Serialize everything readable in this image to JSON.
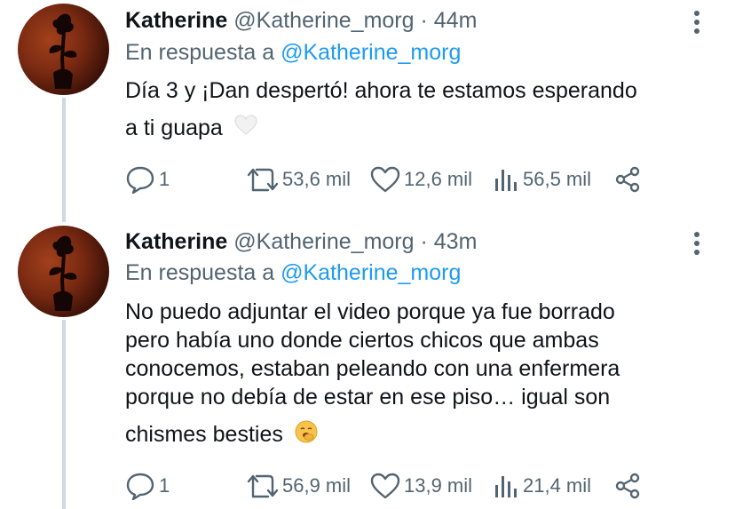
{
  "tweets": [
    {
      "author_name": "Katherine",
      "handle": "@Katherine_morg",
      "separator": "·",
      "time": "44m",
      "reply_prefix": "En respuesta a",
      "reply_handle": "@Katherine_morg",
      "text_lines": [
        "Día 3 y ¡Dan despertó! ahora te estamos esperando",
        "a ti guapa"
      ],
      "emoji": "white-heart-icon",
      "replies": "1",
      "retweets": "53,6 mil",
      "likes": "12,6 mil",
      "views": "56,5 mil"
    },
    {
      "author_name": "Katherine",
      "handle": "@Katherine_morg",
      "separator": "·",
      "time": "43m",
      "reply_prefix": "En respuesta a",
      "reply_handle": "@Katherine_morg",
      "text_lines": [
        "No puedo adjuntar el video porque ya fue borrado",
        "pero había uno donde ciertos chicos que ambas",
        "conocemos, estaban peleando con una enfermera",
        "porque no debía de estar en ese piso… igual son",
        "chismes besties"
      ],
      "emoji": "yawning-face-icon",
      "replies": "1",
      "retweets": "56,9 mil",
      "likes": "13,9 mil",
      "views": "21,4 mil"
    }
  ],
  "colors": {
    "text": "#0f1419",
    "muted": "#536471",
    "link": "#1d9bf0",
    "thread_line": "#cfd9de"
  }
}
